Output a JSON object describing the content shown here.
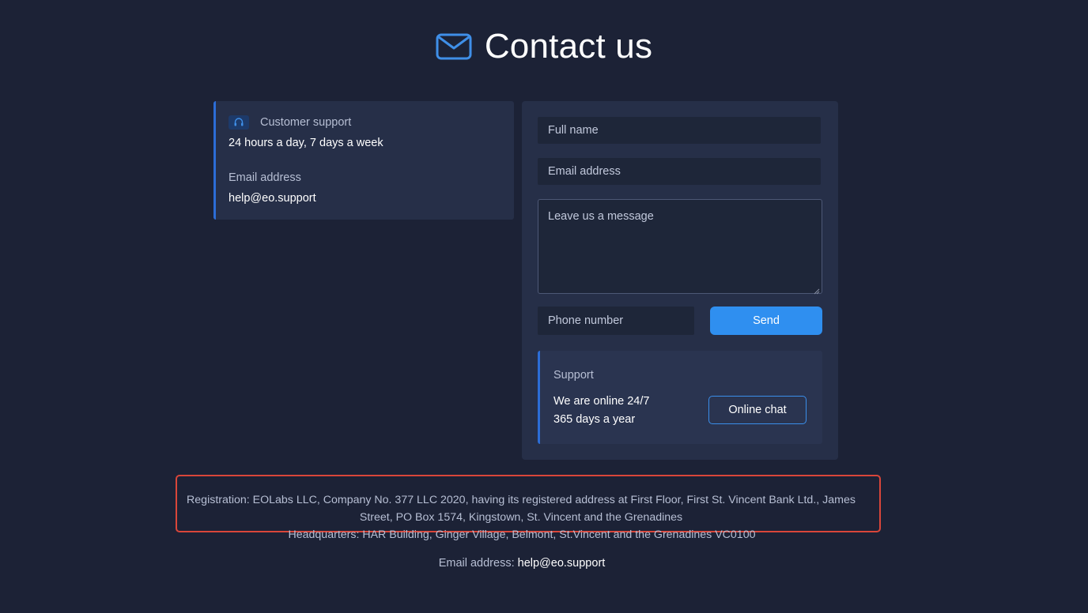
{
  "header": {
    "icon": "envelope-icon",
    "title": "Contact us"
  },
  "support_info": {
    "icon": "headset-icon",
    "label": "Customer support",
    "hours": "24 hours a day, 7 days a week",
    "email_label": "Email address",
    "email": "help@eo.support"
  },
  "form": {
    "full_name_placeholder": "Full name",
    "email_placeholder": "Email address",
    "message_placeholder": "Leave us a message",
    "phone_placeholder": "Phone number",
    "send_label": "Send"
  },
  "chat": {
    "label": "Support",
    "line1": "We are online 24/7",
    "line2": "365 days a year",
    "button_label": "Online chat"
  },
  "footer": {
    "registration": "Registration: EOLabs LLC, Company No. 377 LLC 2020, having its registered address at First Floor, First St. Vincent Bank Ltd., James Street, PO Box 1574, Kingstown, St. Vincent and the Grenadines",
    "headquarters": "Headquarters: HAR Building, Ginger Village, Belmont, St.Vincent and the Grenadines VC0100",
    "email_label": "Email address:",
    "email": "help@eo.support"
  },
  "colors": {
    "background": "#1c2236",
    "card": "#262f48",
    "accent": "#2f8ff0",
    "highlight_border": "#d9463a"
  }
}
